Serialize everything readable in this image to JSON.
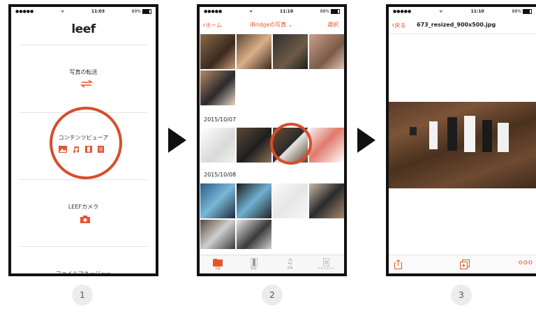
{
  "colors": {
    "accent": "#e8542a",
    "circle": "#d94c2b"
  },
  "phone1": {
    "status_carrier": "●●●●●",
    "status_wifi": "ᯤ",
    "status_time": "11:03",
    "status_battery": "89%",
    "logo": "leef",
    "menu": [
      {
        "label": "写真の転送",
        "icon": "transfer-arrows-icon"
      },
      {
        "label": "コンテンツビューア",
        "icons": [
          "photo-icon",
          "music-icon",
          "video-icon",
          "document-icon"
        ]
      },
      {
        "label": "LEEFカメラ",
        "icon": "camera-icon"
      },
      {
        "label": "ファイルマネージャー"
      }
    ]
  },
  "phone2": {
    "status_carrier": "●●●●●",
    "status_wifi": "ᯤ",
    "status_time": "11:10",
    "status_battery": "88%",
    "back_label": "ホーム",
    "title": "iBridgeの写真",
    "select_label": "選択",
    "sections": [
      "2015/10/07",
      "2015/10/08"
    ],
    "tabs": [
      {
        "label": "写真",
        "icon": "photo-tab-icon"
      },
      {
        "label": "動画",
        "icon": "video-tab-icon"
      },
      {
        "label": "音楽",
        "icon": "music-tab-icon"
      },
      {
        "label": "ドキュメント",
        "icon": "document-tab-icon"
      }
    ]
  },
  "phone3": {
    "status_carrier": "●●●●●",
    "status_wifi": "ᯤ",
    "status_time": "11:10",
    "status_battery": "88%",
    "back_label": "戻る",
    "filename": "673_resized_900x500.jpg"
  },
  "steps": [
    "1",
    "2",
    "3"
  ]
}
